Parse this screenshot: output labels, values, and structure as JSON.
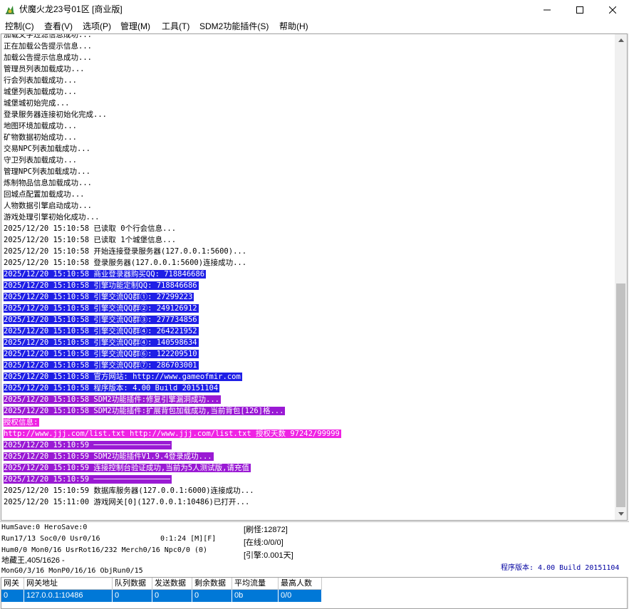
{
  "window": {
    "title": "伏魔火龙23号01区 [商业版]",
    "icon": "game-app-icon",
    "controls": [
      "minimize-icon",
      "maximize-icon",
      "close-icon"
    ]
  },
  "menu": [
    {
      "label": "控制(C)"
    },
    {
      "label": "查看(V)"
    },
    {
      "label": "选项(P)"
    },
    {
      "label": "管理(M)"
    },
    {
      "label": "工具(T)"
    },
    {
      "label": "SDM2功能插件(S)"
    },
    {
      "label": "帮助(H)"
    }
  ],
  "log": {
    "colors": {
      "blue": "#1f1fe6",
      "purple": "#9a1ad4",
      "magenta": "#ef23e3"
    },
    "lines": [
      {
        "text": "加载文字过滤信息成功...",
        "style": ""
      },
      {
        "text": "正在加载公告提示信息...",
        "style": ""
      },
      {
        "text": "加载公告提示信息成功...",
        "style": ""
      },
      {
        "text": "管理员列表加载成功...",
        "style": ""
      },
      {
        "text": "行会列表加载成功...",
        "style": ""
      },
      {
        "text": "城堡列表加载成功...",
        "style": ""
      },
      {
        "text": "城堡城初始完成...",
        "style": ""
      },
      {
        "text": "登录服务器连接初始化完成...",
        "style": ""
      },
      {
        "text": "地图环境加载成功...",
        "style": ""
      },
      {
        "text": "矿物数据初始成功...",
        "style": ""
      },
      {
        "text": "交易NPC列表加载成功...",
        "style": ""
      },
      {
        "text": "守卫列表加载成功...",
        "style": ""
      },
      {
        "text": "管理NPC列表加载成功...",
        "style": ""
      },
      {
        "text": "炼制物品信息加载成功...",
        "style": ""
      },
      {
        "text": "回城点配置加载成功...",
        "style": ""
      },
      {
        "text": "人物数据引擎启动成功...",
        "style": ""
      },
      {
        "text": "游戏处理引擎初始化成功...",
        "style": ""
      },
      {
        "text": "2025/12/20 15:10:58 已读取 0个行会信息...",
        "style": ""
      },
      {
        "text": "2025/12/20 15:10:58 已读取 1个城堡信息...",
        "style": ""
      },
      {
        "text": "2025/12/20 15:10:58 开始连接登录服务器(127.0.0.1:5600)...",
        "style": ""
      },
      {
        "text": "2025/12/20 15:10:58 登录服务器(127.0.0.1:5600)连接成功...",
        "style": ""
      },
      {
        "text": "2025/12/20 15:10:58 商业登录器购买QQ: 718846686",
        "style": "blue"
      },
      {
        "text": "2025/12/20 15:10:58 引擎功能定制QQ: 718846686",
        "style": "blue"
      },
      {
        "text": "2025/12/20 15:10:58 引擎交流QQ群①: 27299223",
        "style": "blue"
      },
      {
        "text": "2025/12/20 15:10:58 引擎交流QQ群②: 249126912",
        "style": "blue"
      },
      {
        "text": "2025/12/20 15:10:58 引擎交流QQ群③: 277734856",
        "style": "blue"
      },
      {
        "text": "2025/12/20 15:10:58 引擎交流QQ群④: 264221952",
        "style": "blue"
      },
      {
        "text": "2025/12/20 15:10:58 引擎交流QQ群④: 140598634",
        "style": "blue"
      },
      {
        "text": "2025/12/20 15:10:58 引擎交流QQ群⑥: 122209510",
        "style": "blue"
      },
      {
        "text": "2025/12/20 15:10:58 引擎交流QQ群⑦: 286703001",
        "style": "blue"
      },
      {
        "text": "2025/12/20 15:10:58 官方网站: http://www.gameofmir.com",
        "style": "blue"
      },
      {
        "text": "2025/12/20 15:10:58 程序版本: 4.00 Build 20151104",
        "style": "blue"
      },
      {
        "text": "2025/12/20 15:10:58 SDM2功能插件:修复引擎漏洞成功...",
        "style": "purple"
      },
      {
        "text": "2025/12/20 15:10:58 SDM2功能插件:扩展背包加载成功,当前背包[126]格...",
        "style": "purple"
      },
      {
        "text": "授权信息:",
        "style": "magenta"
      },
      {
        "text": "http://www.jjj.com/list.txt http://www.jjj.com/list.txt 授权天数 97242/99999",
        "style": "magenta"
      },
      {
        "text": "2025/12/20 15:10:59 ─────────────────",
        "style": "purple"
      },
      {
        "text": "2025/12/20 15:10:59 SDM2功能插件V1.9.4登录成功...",
        "style": "purple"
      },
      {
        "text": "2025/12/20 15:10:59 连接控制台验证成功,当前为5人测试版,请充值",
        "style": "purple"
      },
      {
        "text": "2025/12/20 15:10:59 ─────────────────",
        "style": "purple"
      },
      {
        "text": "2025/12/20 15:10:59 数据库服务器(127.0.0.1:6000)连接成功...",
        "style": ""
      },
      {
        "text": "2025/12/20 15:11:00 游戏网关[0](127.0.0.1:10486)已打开...",
        "style": ""
      }
    ]
  },
  "status": {
    "line1": "HumSave:0 HeroSave:0",
    "line2": "Run17/13 Soc0/0 Usr0/16",
    "timer": "0:1:24 [M][F]",
    "line3": "Hum0/0 Mon0/16 UsrRot16/232 Merch0/16 Npc0/0 (0)",
    "line4": "地藏王,405/1626 -",
    "line5": "MonG0/3/16 MonP0/16/16 ObjRun0/15",
    "refresh": "[刷怪:12872]",
    "online": "[在线:0/0/0]",
    "engine": "[引擎:0.001天]",
    "version": "程序版本: 4.00 Build 20151104"
  },
  "gateway_table": {
    "columns": [
      "网关",
      "网关地址",
      "队列数据",
      "发送数据",
      "剩余数据",
      "平均流量",
      "最高人数"
    ],
    "rows": [
      [
        "0",
        "127.0.0.1:10486",
        "0",
        "0",
        "0",
        "0b",
        "0/0"
      ]
    ]
  }
}
